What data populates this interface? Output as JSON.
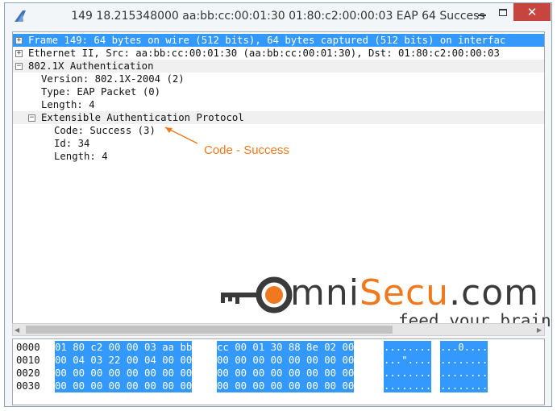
{
  "window": {
    "title": "149 18.215348000 aa:bb:cc:00:01:30 01:80:c2:00:00:03 EAP 64 Success",
    "min_icon": "minimize-icon",
    "max_icon": "maximize-icon",
    "close_label": "✕"
  },
  "tree": {
    "rows": [
      {
        "expander": "+",
        "text": "Frame 149: 64 bytes on wire (512 bits), 64 bytes captured (512 bits) on interfac"
      },
      {
        "expander": "+",
        "text": "Ethernet II, Src: aa:bb:cc:00:01:30 (aa:bb:cc:00:01:30), Dst: 01:80:c2:00:00:03"
      },
      {
        "expander": "−",
        "text": "802.1X Authentication"
      },
      {
        "expander": "",
        "text": "Version: 802.1X-2004 (2)"
      },
      {
        "expander": "",
        "text": "Type: EAP Packet (0)"
      },
      {
        "expander": "",
        "text": "Length: 4"
      },
      {
        "expander": "−",
        "text": "Extensible Authentication Protocol"
      },
      {
        "expander": "",
        "text": "Code: Success (3)"
      },
      {
        "expander": "",
        "text": "Id: 34"
      },
      {
        "expander": "",
        "text": "Length: 4"
      }
    ]
  },
  "annotation": {
    "label": "Code - Success"
  },
  "logo": {
    "word_start": "mni",
    "word_accent": "Secu",
    "word_end": ".com",
    "tagline": "feed your brain"
  },
  "hex": {
    "rows": [
      {
        "offset": "0000",
        "bytes1": "01 80 c2 00 00 03 aa bb",
        "bytes2": "cc 00 01 30 88 8e 02 00",
        "ascii1": "........",
        "ascii2": "...0...."
      },
      {
        "offset": "0010",
        "bytes1": "00 04 03 22 00 04 00 00",
        "bytes2": "00 00 00 00 00 00 00 00",
        "ascii1": "...\"....",
        "ascii2": "........"
      },
      {
        "offset": "0020",
        "bytes1": "00 00 00 00 00 00 00 00",
        "bytes2": "00 00 00 00 00 00 00 00",
        "ascii1": "........",
        "ascii2": "........"
      },
      {
        "offset": "0030",
        "bytes1": "00 00 00 00 00 00 00 00",
        "bytes2": "00 00 00 00 00 00 00 00",
        "ascii1": "........",
        "ascii2": "........"
      }
    ]
  },
  "colors": {
    "selection": "#3399ff",
    "accent": "#f07920",
    "close": "#c7453e"
  }
}
